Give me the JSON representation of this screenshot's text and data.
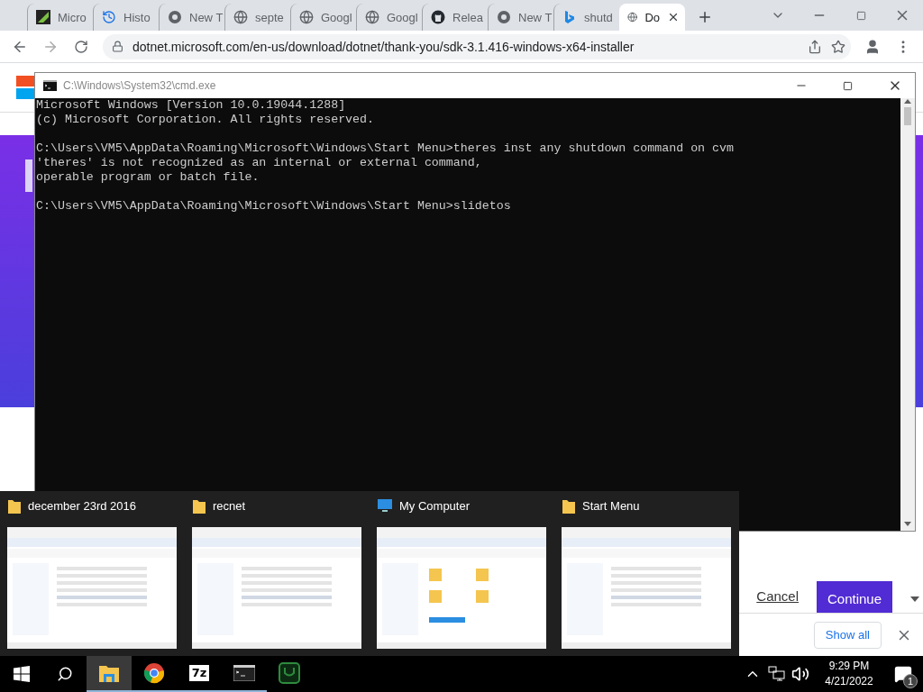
{
  "browser": {
    "tabs": [
      {
        "label": "Micro",
        "kind": "app",
        "selected": false
      },
      {
        "label": "Histo",
        "kind": "history",
        "selected": false
      },
      {
        "label": "New T",
        "kind": "newtab",
        "selected": false
      },
      {
        "label": "septe",
        "kind": "web",
        "selected": false
      },
      {
        "label": "Googl",
        "kind": "web",
        "selected": false
      },
      {
        "label": "Googl",
        "kind": "web",
        "selected": false
      },
      {
        "label": "Relea",
        "kind": "repo",
        "selected": false
      },
      {
        "label": "New T",
        "kind": "newtab",
        "selected": false
      },
      {
        "label": "shutd",
        "kind": "search",
        "selected": false
      },
      {
        "label": "Do",
        "kind": "web",
        "selected": true
      }
    ],
    "address_bar": {
      "url": "dotnet.microsoft.com/en-us/download/dotnet/thank-you/sdk-3.1.416-windows-x64-installer"
    },
    "page": {
      "cancel": "Cancel",
      "continue": "Continue"
    },
    "download_bar": {
      "show_all": "Show all"
    }
  },
  "console_window": {
    "title": "C:\\Windows\\System32\\cmd.exe",
    "blocks": [
      [
        "Microsoft Windows [Version 10.0.19044.1288]",
        "(c) Microsoft Corporation. All rights reserved."
      ],
      [
        "C:\\Users\\VM5\\AppData\\Roaming\\Microsoft\\Windows\\Start Menu>theres inst any shutdown command on cvm",
        "'theres' is not recognized as an internal or external command,",
        "operable program or batch file."
      ],
      [
        "C:\\Users\\VM5\\AppData\\Roaming\\Microsoft\\Windows\\Start Menu>slidetos"
      ]
    ]
  },
  "thumbnails": [
    {
      "title": "december 23rd 2016",
      "kind": "folder"
    },
    {
      "title": "recnet",
      "kind": "folder"
    },
    {
      "title": "My Computer",
      "kind": "computer"
    },
    {
      "title": "Start Menu",
      "kind": "folder"
    }
  ],
  "taskbar": {
    "apps": [
      {
        "kind": "explorer",
        "selected": true,
        "running": true
      },
      {
        "kind": "chrome",
        "selected": false,
        "running": true
      },
      {
        "kind": "archiver",
        "label": "7z",
        "selected": false,
        "running": true
      },
      {
        "kind": "terminal",
        "selected": false,
        "running": true
      },
      {
        "kind": "green",
        "selected": false,
        "running": false
      }
    ],
    "time": "9:29 PM",
    "date": "4/21/2022",
    "notification_count": "1"
  }
}
